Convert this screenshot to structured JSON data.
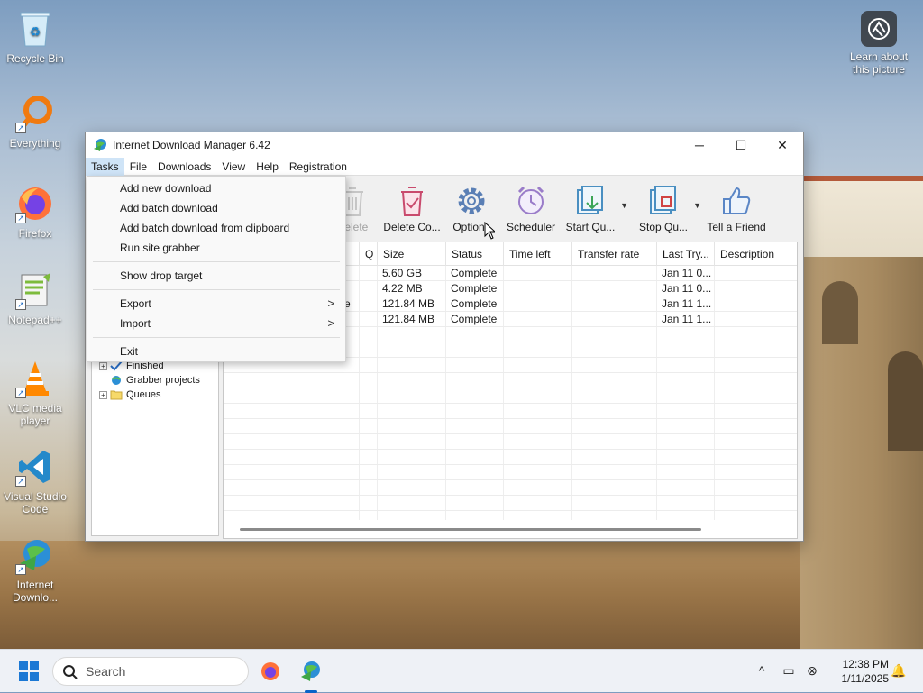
{
  "desktop": {
    "icons": [
      {
        "label": "Recycle Bin"
      },
      {
        "label": "Everything"
      },
      {
        "label": "Firefox"
      },
      {
        "label": "Notepad++"
      },
      {
        "label": "VLC media player"
      },
      {
        "label": "Visual Studio Code"
      },
      {
        "label": "Internet Downlo..."
      }
    ],
    "learn_about": "Learn about this picture"
  },
  "window": {
    "title": "Internet Download Manager 6.42",
    "menu": [
      "Tasks",
      "File",
      "Downloads",
      "View",
      "Help",
      "Registration"
    ],
    "toolbar": [
      {
        "label": "Delete",
        "icon": "trash-icon",
        "disabled": true
      },
      {
        "label": "Delete Co...",
        "icon": "delete-completed-icon"
      },
      {
        "label": "Options",
        "icon": "gear-icon"
      },
      {
        "label": "Scheduler",
        "icon": "alarm-clock-icon"
      },
      {
        "label": "Start Qu...",
        "icon": "start-queue-icon"
      },
      {
        "label": "Stop Qu...",
        "icon": "stop-queue-icon"
      },
      {
        "label": "Tell a Friend",
        "icon": "thumbs-up-icon"
      }
    ],
    "tree": [
      "Finished",
      "Grabber projects",
      "Queues"
    ],
    "columns": [
      "Q",
      "Size",
      "Status",
      "Time left",
      "Transfer rate",
      "Last Try...",
      "Description"
    ],
    "rows": [
      {
        "name": "...",
        "size": "5.60  GB",
        "status": "Complete",
        "last_try": "Jan 11 0..."
      },
      {
        "name": "",
        "size": "4.22  MB",
        "status": "Complete",
        "last_try": "Jan 11 0..."
      },
      {
        "name": "e",
        "size": "121.84  MB",
        "status": "Complete",
        "last_try": "Jan 11 1..."
      },
      {
        "name": "...",
        "size": "121.84  MB",
        "status": "Complete",
        "last_try": "Jan 11 1..."
      }
    ]
  },
  "tasks_menu": {
    "items": [
      "Add new download",
      "Add batch download",
      "Add batch download from clipboard",
      "Run site grabber",
      "Show drop target",
      "Export",
      "Import",
      "Exit"
    ],
    "submenu_arrow": ">"
  },
  "taskbar": {
    "search_placeholder": "Search",
    "time": "12:38 PM",
    "date": "1/11/2025"
  }
}
